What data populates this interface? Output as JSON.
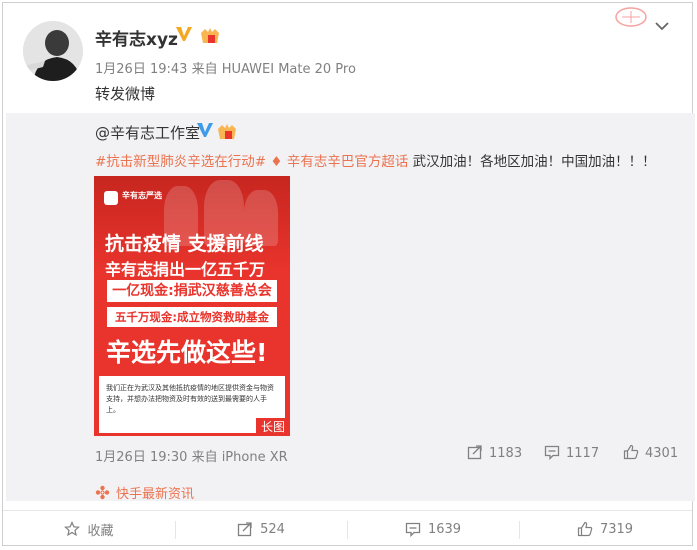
{
  "post": {
    "author": "辛有志xyz",
    "time": "1月26日 19:43",
    "via": "来自 HUAWEI Mate 20 Pro",
    "content": "转发微博"
  },
  "repost": {
    "author": "@辛有志工作室",
    "hashtag": "#抗击新型肺炎辛选在行动#",
    "supertopic": "辛有志辛巴官方超话",
    "text": "武汉加油！各地区加油！中国加油！！！",
    "poster": {
      "logo": "辛有志严选",
      "line1": "抗击疫情  支援前线",
      "line2": "辛有志捐出一亿五千万",
      "box1": "一亿现金:捐武汉慈善总会",
      "box2": "五千万现金:成立物资救助基金",
      "headline": "辛选先做这些!",
      "paragraph": "我们正在为武汉及其他抵抗疫情的地区提供资金与物资支持，并想办法把物资及时有效的送到最需要的人手上。",
      "long_label": "长图"
    },
    "time": "1月26日 19:30",
    "via": "来自 iPhone XR",
    "reposts": "1183",
    "comments": "1117",
    "likes": "4301"
  },
  "source_label": "快手最新资讯",
  "actions": {
    "favorite": "收藏",
    "repost": "524",
    "comment": "1639",
    "like": "7319"
  }
}
